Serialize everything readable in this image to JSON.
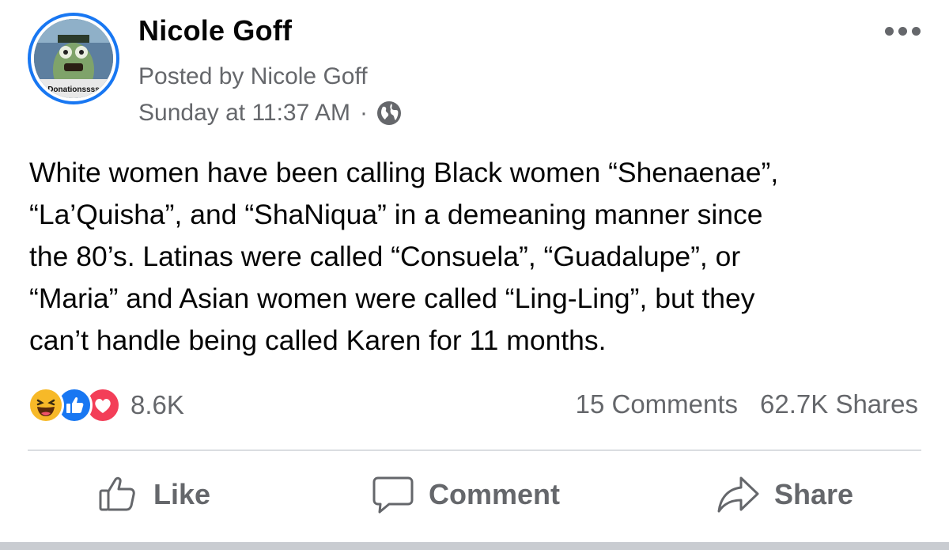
{
  "post": {
    "author": "Nicole Goff",
    "posted_by": "Posted by Nicole Goff",
    "timestamp": "Sunday at 11:37 AM",
    "separator": "·",
    "avatar_caption": "Donationssss",
    "body": "White women have been calling Black women “Shenaenae”,\n“La’Quisha”, and “ShaNiqua” in a demeaning manner since\nthe 80’s. Latinas were called “Consuela”, “Guadalupe”, or\n“Maria” and Asian women were called “Ling-Ling”, but they\ncan’t handle being called Karen for 11 months."
  },
  "stats": {
    "reactions_count": "8.6K",
    "reactions": [
      "haha-icon",
      "like-icon",
      "love-icon"
    ],
    "comments": "15 Comments",
    "shares": "62.7K Shares"
  },
  "actions": {
    "like_label": "Like",
    "comment_label": "Comment",
    "share_label": "Share"
  },
  "icons": {
    "privacy": "globe-icon",
    "more": "more-options-icon"
  },
  "colors": {
    "brand_blue": "#1877f2",
    "secondary_text": "#65676b",
    "primary_text": "#050505",
    "haha": "#f7b928",
    "love": "#f33e58"
  }
}
